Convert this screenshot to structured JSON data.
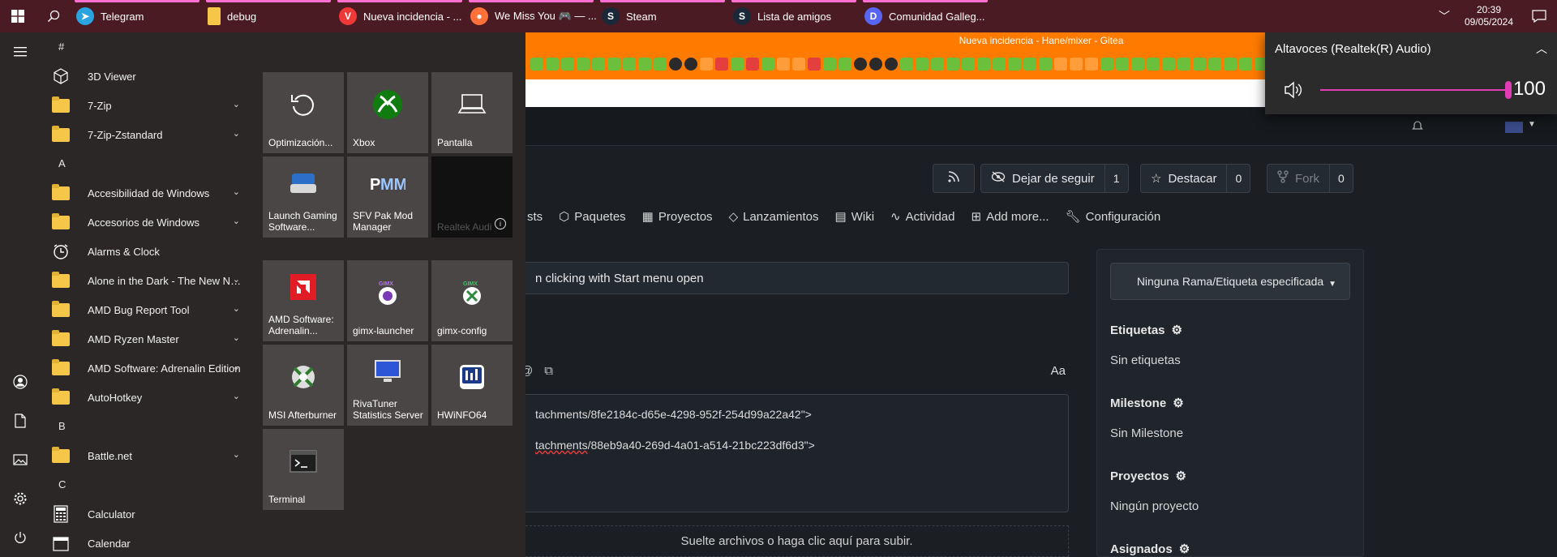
{
  "taskbar": {
    "apps": [
      {
        "label": "Telegram",
        "color": "#2aa3df",
        "glyph": "➤"
      },
      {
        "label": "debug",
        "color": "#f5c647",
        "glyph": ""
      },
      {
        "label": "Nueva incidencia - ...",
        "color": "#ef3939",
        "glyph": "V"
      },
      {
        "label": "We Miss You 🎮 — ...",
        "color": "#ff7139",
        "glyph": "●"
      },
      {
        "label": "Steam",
        "color": "#1b2838",
        "glyph": "S"
      },
      {
        "label": "Lista de amigos",
        "color": "#1b2838",
        "glyph": "S"
      },
      {
        "label": "Comunidad Galleg...",
        "color": "#5865f2",
        "glyph": "D"
      }
    ],
    "time": "20:39",
    "date": "09/05/2024"
  },
  "browser": {
    "title": "Nueva incidencia - Hane/mixer - Gitea"
  },
  "gitea": {
    "unwatch_label": "Dejar de seguir",
    "unwatch_count": "1",
    "star_label": "Destacar",
    "star_count": "0",
    "fork_label": "Fork",
    "fork_count": "0",
    "tabs": [
      {
        "label": "sts"
      },
      {
        "label": "Paquetes"
      },
      {
        "label": "Proyectos"
      },
      {
        "label": "Lanzamientos"
      },
      {
        "label": "Wiki"
      },
      {
        "label": "Actividad"
      },
      {
        "label": "Add more..."
      },
      {
        "label": "Configuración"
      }
    ],
    "issue_title": "n clicking with Start menu open",
    "editor_aa": "Aa",
    "editor_lines": [
      "tachments/8fe2184c-d65e-4298-952f-254d99a22a42\">",
      "tachments/88eb9a40-269d-4a01-a514-21bc223df6d3\">"
    ],
    "upload_text": "Suelte archivos o haga clic aquí para subir.",
    "branch_label": "Ninguna Rama/Etiqueta especificada",
    "sidebar": {
      "labels_title": "Etiquetas",
      "labels_value": "Sin etiquetas",
      "milestone_title": "Milestone",
      "milestone_value": "Sin Milestone",
      "projects_title": "Proyectos",
      "projects_value": "Ningún proyecto",
      "assignees_title": "Asignados"
    }
  },
  "volume": {
    "device": "Altavoces (Realtek(R) Audio)",
    "level": 100,
    "accent": "#e03cb4"
  },
  "start_menu": {
    "list": [
      {
        "type": "letter",
        "label": "#"
      },
      {
        "type": "app",
        "label": "3D Viewer",
        "icon": "cube-icon"
      },
      {
        "type": "folder",
        "label": "7-Zip"
      },
      {
        "type": "folder",
        "label": "7-Zip-Zstandard"
      },
      {
        "type": "letter",
        "label": "A"
      },
      {
        "type": "folder",
        "label": "Accesibilidad de Windows"
      },
      {
        "type": "folder",
        "label": "Accesorios de Windows"
      },
      {
        "type": "app",
        "label": "Alarms & Clock",
        "icon": "clock-icon"
      },
      {
        "type": "folder",
        "label": "Alone in the Dark - The New Nigh..."
      },
      {
        "type": "folder",
        "label": "AMD Bug Report Tool"
      },
      {
        "type": "folder",
        "label": "AMD Ryzen Master"
      },
      {
        "type": "folder",
        "label": "AMD Software: Adrenalin Edition"
      },
      {
        "type": "folder",
        "label": "AutoHotkey"
      },
      {
        "type": "letter",
        "label": "B"
      },
      {
        "type": "folder",
        "label": "Battle.net"
      },
      {
        "type": "letter",
        "label": "C"
      },
      {
        "type": "app",
        "label": "Calculator",
        "icon": "calculator-icon"
      },
      {
        "type": "app",
        "label": "Calendar",
        "icon": "calendar-icon"
      }
    ],
    "tiles": [
      {
        "label": "Optimización...",
        "col": 0,
        "row": 0
      },
      {
        "label": "Xbox",
        "col": 1,
        "row": 0
      },
      {
        "label": "Pantalla",
        "col": 2,
        "row": 0
      },
      {
        "label": "Launch Gaming Software...",
        "col": 0,
        "row": 1
      },
      {
        "label": "SFV Pak Mod Manager",
        "col": 1,
        "row": 1
      },
      {
        "label": "Realtek Audi",
        "col": 2,
        "row": 1
      },
      {
        "label": "AMD Software: Adrenalin...",
        "col": 0,
        "row": 2
      },
      {
        "label": "gimx-launcher",
        "col": 1,
        "row": 2
      },
      {
        "label": "gimx-config",
        "col": 2,
        "row": 2
      },
      {
        "label": "MSI Afterburner",
        "col": 0,
        "row": 3
      },
      {
        "label": "RivaTuner Statistics Server",
        "col": 1,
        "row": 3
      },
      {
        "label": "HWiNFO64",
        "col": 2,
        "row": 3
      },
      {
        "label": "Terminal",
        "col": 0,
        "row": 4
      }
    ]
  }
}
